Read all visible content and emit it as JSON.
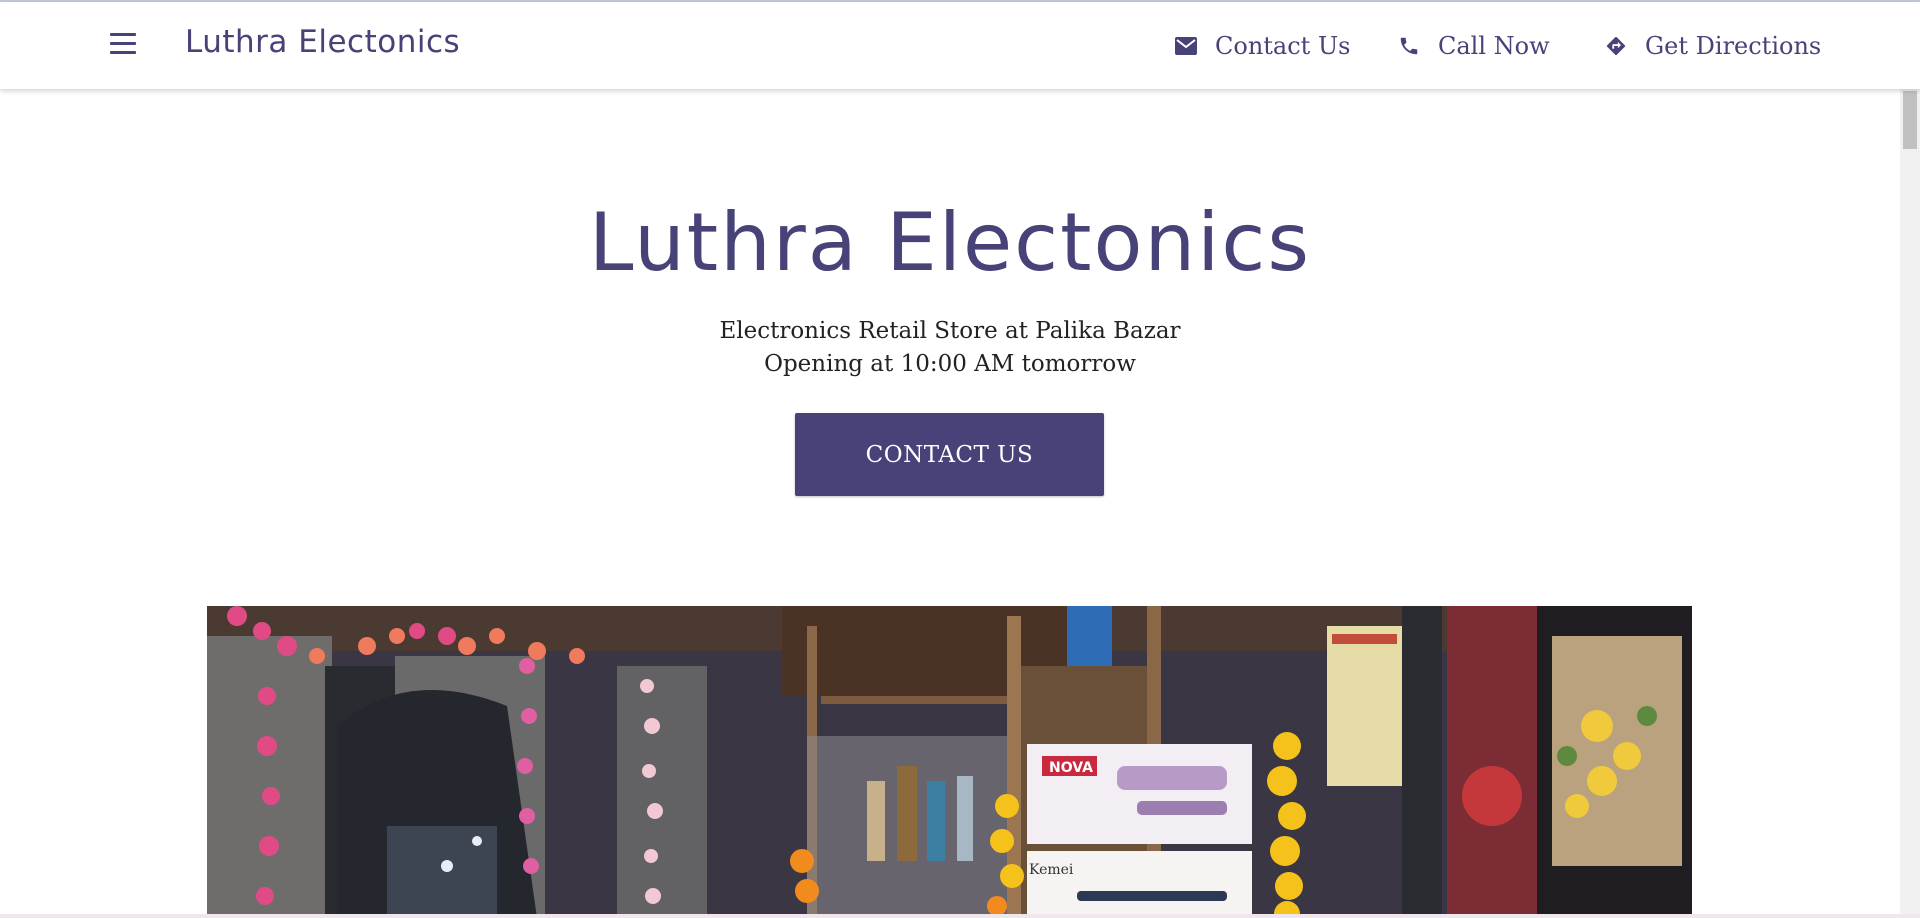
{
  "header": {
    "brand": "Luthra Electonics",
    "nav": [
      {
        "label": "Contact Us",
        "icon": "mail-icon"
      },
      {
        "label": "Call Now",
        "icon": "phone-icon"
      },
      {
        "label": "Get Directions",
        "icon": "directions-icon"
      }
    ]
  },
  "hero": {
    "title": "Luthra Electonics",
    "subtitle": "Electronics Retail Store at Palika Bazar",
    "status": "Opening at 10:00 AM tomorrow",
    "cta_label": "CONTACT US"
  },
  "photo": {
    "box_brand": "NOVA",
    "box_brand_2": "Kemei"
  },
  "colors": {
    "accent": "#474277",
    "text": "#222222",
    "background": "#ffffff"
  }
}
